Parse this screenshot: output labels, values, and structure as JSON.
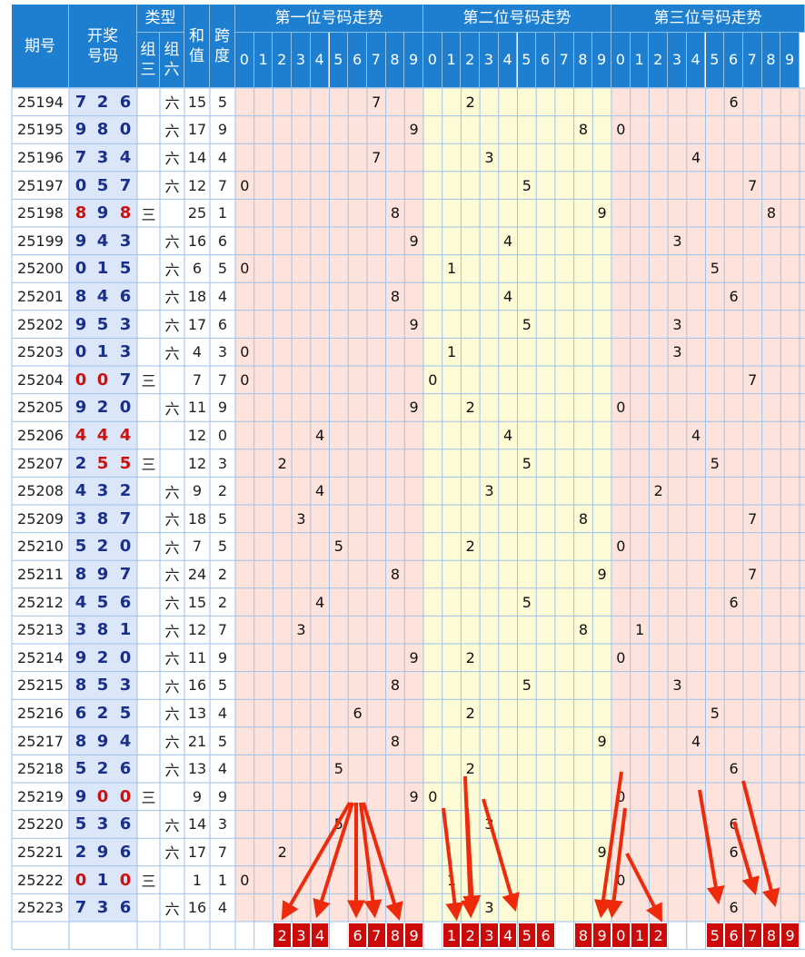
{
  "header": {
    "qihao": "期号",
    "kaijiang": [
      "开奖",
      "号码"
    ],
    "leixing": "类型",
    "zusan": [
      "组",
      "三"
    ],
    "zuliu": [
      "组",
      "六"
    ],
    "hezhi": [
      "和",
      "值"
    ],
    "kuadu": [
      "跨",
      "度"
    ],
    "groups": [
      "第一位号码走势",
      "第二位号码走势",
      "第三位号码走势"
    ],
    "digits": [
      "0",
      "1",
      "2",
      "3",
      "4",
      "5",
      "6",
      "7",
      "8",
      "9"
    ]
  },
  "colors": {
    "header_bg": "#1e7fd0",
    "group1_bg": "#fde3dc",
    "group2_bg": "#fdfbd6",
    "group3_bg": "#fde3dc",
    "number_col_bg": "#dbe7f9",
    "digit_blue": "#1a2f8a",
    "digit_red": "#cc1111",
    "footer_red": "#cc0a0a",
    "arrow_red": "#ee2a0c"
  },
  "chart_data": {
    "type": "table",
    "rows": [
      {
        "period": "25194",
        "numbers": [
          7,
          2,
          6
        ],
        "type": "六",
        "sum": 15,
        "span": 5
      },
      {
        "period": "25195",
        "numbers": [
          9,
          8,
          0
        ],
        "type": "六",
        "sum": 17,
        "span": 9
      },
      {
        "period": "25196",
        "numbers": [
          7,
          3,
          4
        ],
        "type": "六",
        "sum": 14,
        "span": 4
      },
      {
        "period": "25197",
        "numbers": [
          0,
          5,
          7
        ],
        "type": "六",
        "sum": 12,
        "span": 7
      },
      {
        "period": "25198",
        "numbers": [
          8,
          9,
          8
        ],
        "type": "三",
        "sum": 25,
        "span": 1
      },
      {
        "period": "25199",
        "numbers": [
          9,
          4,
          3
        ],
        "type": "六",
        "sum": 16,
        "span": 6
      },
      {
        "period": "25200",
        "numbers": [
          0,
          1,
          5
        ],
        "type": "六",
        "sum": 6,
        "span": 5
      },
      {
        "period": "25201",
        "numbers": [
          8,
          4,
          6
        ],
        "type": "六",
        "sum": 18,
        "span": 4
      },
      {
        "period": "25202",
        "numbers": [
          9,
          5,
          3
        ],
        "type": "六",
        "sum": 17,
        "span": 6
      },
      {
        "period": "25203",
        "numbers": [
          0,
          1,
          3
        ],
        "type": "六",
        "sum": 4,
        "span": 3
      },
      {
        "period": "25204",
        "numbers": [
          0,
          0,
          7
        ],
        "type": "三",
        "sum": 7,
        "span": 7
      },
      {
        "period": "25205",
        "numbers": [
          9,
          2,
          0
        ],
        "type": "六",
        "sum": 11,
        "span": 9
      },
      {
        "period": "25206",
        "numbers": [
          4,
          4,
          4
        ],
        "type": "",
        "sum": 12,
        "span": 0
      },
      {
        "period": "25207",
        "numbers": [
          2,
          5,
          5
        ],
        "type": "三",
        "sum": 12,
        "span": 3
      },
      {
        "period": "25208",
        "numbers": [
          4,
          3,
          2
        ],
        "type": "六",
        "sum": 9,
        "span": 2
      },
      {
        "period": "25209",
        "numbers": [
          3,
          8,
          7
        ],
        "type": "六",
        "sum": 18,
        "span": 5
      },
      {
        "period": "25210",
        "numbers": [
          5,
          2,
          0
        ],
        "type": "六",
        "sum": 7,
        "span": 5
      },
      {
        "period": "25211",
        "numbers": [
          8,
          9,
          7
        ],
        "type": "六",
        "sum": 24,
        "span": 2
      },
      {
        "period": "25212",
        "numbers": [
          4,
          5,
          6
        ],
        "type": "六",
        "sum": 15,
        "span": 2
      },
      {
        "period": "25213",
        "numbers": [
          3,
          8,
          1
        ],
        "type": "六",
        "sum": 12,
        "span": 7
      },
      {
        "period": "25214",
        "numbers": [
          9,
          2,
          0
        ],
        "type": "六",
        "sum": 11,
        "span": 9
      },
      {
        "period": "25215",
        "numbers": [
          8,
          5,
          3
        ],
        "type": "六",
        "sum": 16,
        "span": 5
      },
      {
        "period": "25216",
        "numbers": [
          6,
          2,
          5
        ],
        "type": "六",
        "sum": 13,
        "span": 4
      },
      {
        "period": "25217",
        "numbers": [
          8,
          9,
          4
        ],
        "type": "六",
        "sum": 21,
        "span": 5
      },
      {
        "period": "25218",
        "numbers": [
          5,
          2,
          6
        ],
        "type": "六",
        "sum": 13,
        "span": 4
      },
      {
        "period": "25219",
        "numbers": [
          9,
          0,
          0
        ],
        "type": "三",
        "sum": 9,
        "span": 9
      },
      {
        "period": "25220",
        "numbers": [
          5,
          3,
          6
        ],
        "type": "六",
        "sum": 14,
        "span": 3
      },
      {
        "period": "25221",
        "numbers": [
          2,
          9,
          6
        ],
        "type": "六",
        "sum": 17,
        "span": 7
      },
      {
        "period": "25222",
        "numbers": [
          0,
          1,
          0
        ],
        "type": "三",
        "sum": 1,
        "span": 1
      },
      {
        "period": "25223",
        "numbers": [
          7,
          3,
          6
        ],
        "type": "六",
        "sum": 16,
        "span": 4
      }
    ],
    "prediction": {
      "pos1": [
        2,
        3,
        4,
        6,
        7,
        8,
        9
      ],
      "pos2": [
        1,
        2,
        3,
        4,
        5,
        6,
        8,
        9
      ],
      "pos3": [
        0,
        1,
        2,
        5,
        6,
        7,
        8,
        9
      ]
    }
  }
}
